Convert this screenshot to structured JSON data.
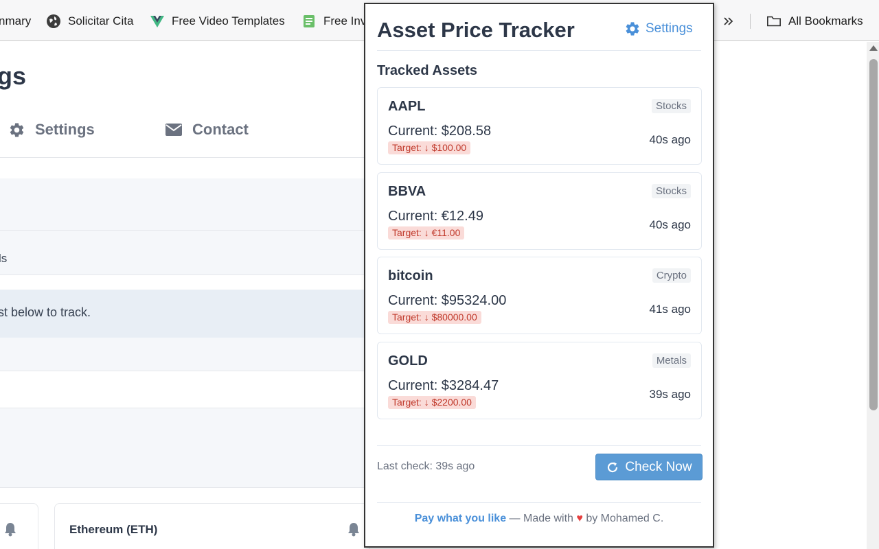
{
  "bookmarks": {
    "items": [
      {
        "label": "nmary"
      },
      {
        "label": "Solicitar Cita",
        "icon": "globe-icon"
      },
      {
        "label": "Free Video Templates",
        "icon": "vue-logo-icon"
      },
      {
        "label": "Free Inv",
        "icon": "invoice-icon"
      }
    ],
    "overflow_icon": "chevrons-right-icon",
    "all_bookmarks_label": "All Bookmarks",
    "all_bookmarks_icon": "folder-icon"
  },
  "background_page": {
    "title": "gs",
    "nav": [
      {
        "label": "Settings",
        "icon": "gear-icon"
      },
      {
        "label": "Contact",
        "icon": "mail-icon"
      }
    ],
    "text_fragment_1": "ls",
    "text_fragment_2": "st below to track.",
    "card_title": "Ethereum (ETH)"
  },
  "popup": {
    "title": "Asset Price Tracker",
    "settings_label": "Settings",
    "section_title": "Tracked Assets",
    "assets": [
      {
        "name": "AAPL",
        "category": "Stocks",
        "current": "Current: $208.58",
        "target": "Target: ↓ $100.00",
        "ago": "40s ago"
      },
      {
        "name": "BBVA",
        "category": "Stocks",
        "current": "Current: €12.49",
        "target": "Target: ↓ €11.00",
        "ago": "40s ago"
      },
      {
        "name": "bitcoin",
        "category": "Crypto",
        "current": "Current: $95324.00",
        "target": "Target: ↓ $80000.00",
        "ago": "41s ago"
      },
      {
        "name": "GOLD",
        "category": "Metals",
        "current": "Current: $3284.47",
        "target": "Target: ↓ $2200.00",
        "ago": "39s ago"
      }
    ],
    "last_check": "Last check: 39s ago",
    "check_now_label": "Check Now",
    "footer": {
      "pay_label": "Pay what you like",
      "made_with": " — Made with ",
      "heart": "♥",
      "by": " by Mohamed C."
    }
  },
  "colors": {
    "accent": "#4a90d9",
    "button": "#5b9bd5",
    "target_bg": "#fadbd8",
    "target_text": "#c0392b",
    "heart": "#e53e3e"
  }
}
